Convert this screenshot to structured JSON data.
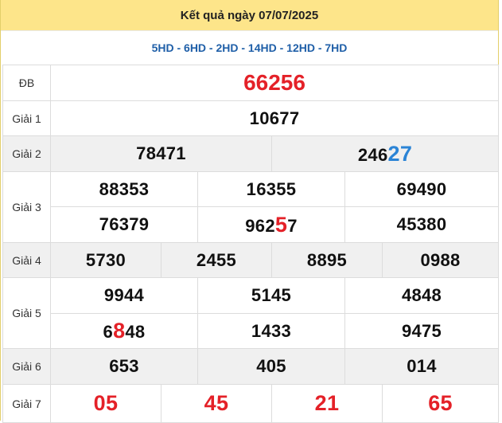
{
  "header": {
    "title": "Kết quả ngày 07/07/2025"
  },
  "codes": "5HD - 6HD - 2HD - 14HD - 12HD - 7HD",
  "colors": {
    "header_bg": "#fde58a",
    "accent_red": "#e42128",
    "accent_blue": "#2b84d6",
    "codes_blue": "#1f5fa8"
  },
  "prizes": {
    "db": {
      "label": "ĐB",
      "value": "66256"
    },
    "g1": {
      "label": "Giải 1",
      "values": [
        "10677"
      ]
    },
    "g2": {
      "label": "Giải 2",
      "values": [
        {
          "pre": "78471",
          "hl": ""
        },
        {
          "pre": "246",
          "hl": "27"
        }
      ]
    },
    "g3": {
      "label": "Giải 3",
      "values": [
        {
          "pre": "88353",
          "hl": "",
          "post": ""
        },
        {
          "pre": "16355",
          "hl": "",
          "post": ""
        },
        {
          "pre": "69490",
          "hl": "",
          "post": ""
        },
        {
          "pre": "76379",
          "hl": "",
          "post": ""
        },
        {
          "pre": "962",
          "hl": "5",
          "post": "7"
        },
        {
          "pre": "45380",
          "hl": "",
          "post": ""
        }
      ]
    },
    "g4": {
      "label": "Giải 4",
      "values": [
        "5730",
        "2455",
        "8895",
        "0988"
      ]
    },
    "g5": {
      "label": "Giải 5",
      "values": [
        {
          "pre": "9944",
          "hl": "",
          "post": ""
        },
        {
          "pre": "5145",
          "hl": "",
          "post": ""
        },
        {
          "pre": "4848",
          "hl": "",
          "post": ""
        },
        {
          "pre": "6",
          "hl": "8",
          "post": "48"
        },
        {
          "pre": "1433",
          "hl": "",
          "post": ""
        },
        {
          "pre": "9475",
          "hl": "",
          "post": ""
        }
      ]
    },
    "g6": {
      "label": "Giải 6",
      "values": [
        "653",
        "405",
        "014"
      ]
    },
    "g7": {
      "label": "Giải 7",
      "values": [
        "05",
        "45",
        "21",
        "65"
      ]
    }
  }
}
